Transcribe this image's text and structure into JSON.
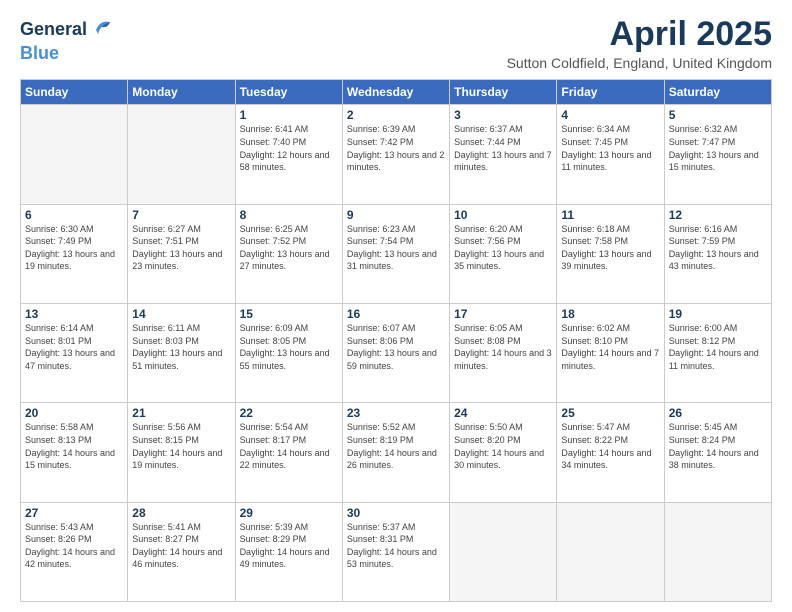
{
  "header": {
    "logo_line1": "General",
    "logo_line2": "Blue",
    "month_title": "April 2025",
    "location": "Sutton Coldfield, England, United Kingdom"
  },
  "weekdays": [
    "Sunday",
    "Monday",
    "Tuesday",
    "Wednesday",
    "Thursday",
    "Friday",
    "Saturday"
  ],
  "weeks": [
    [
      {
        "day": "",
        "empty": true
      },
      {
        "day": "",
        "empty": true
      },
      {
        "day": "1",
        "sunrise": "Sunrise: 6:41 AM",
        "sunset": "Sunset: 7:40 PM",
        "daylight": "Daylight: 12 hours and 58 minutes."
      },
      {
        "day": "2",
        "sunrise": "Sunrise: 6:39 AM",
        "sunset": "Sunset: 7:42 PM",
        "daylight": "Daylight: 13 hours and 2 minutes."
      },
      {
        "day": "3",
        "sunrise": "Sunrise: 6:37 AM",
        "sunset": "Sunset: 7:44 PM",
        "daylight": "Daylight: 13 hours and 7 minutes."
      },
      {
        "day": "4",
        "sunrise": "Sunrise: 6:34 AM",
        "sunset": "Sunset: 7:45 PM",
        "daylight": "Daylight: 13 hours and 11 minutes."
      },
      {
        "day": "5",
        "sunrise": "Sunrise: 6:32 AM",
        "sunset": "Sunset: 7:47 PM",
        "daylight": "Daylight: 13 hours and 15 minutes."
      }
    ],
    [
      {
        "day": "6",
        "sunrise": "Sunrise: 6:30 AM",
        "sunset": "Sunset: 7:49 PM",
        "daylight": "Daylight: 13 hours and 19 minutes."
      },
      {
        "day": "7",
        "sunrise": "Sunrise: 6:27 AM",
        "sunset": "Sunset: 7:51 PM",
        "daylight": "Daylight: 13 hours and 23 minutes."
      },
      {
        "day": "8",
        "sunrise": "Sunrise: 6:25 AM",
        "sunset": "Sunset: 7:52 PM",
        "daylight": "Daylight: 13 hours and 27 minutes."
      },
      {
        "day": "9",
        "sunrise": "Sunrise: 6:23 AM",
        "sunset": "Sunset: 7:54 PM",
        "daylight": "Daylight: 13 hours and 31 minutes."
      },
      {
        "day": "10",
        "sunrise": "Sunrise: 6:20 AM",
        "sunset": "Sunset: 7:56 PM",
        "daylight": "Daylight: 13 hours and 35 minutes."
      },
      {
        "day": "11",
        "sunrise": "Sunrise: 6:18 AM",
        "sunset": "Sunset: 7:58 PM",
        "daylight": "Daylight: 13 hours and 39 minutes."
      },
      {
        "day": "12",
        "sunrise": "Sunrise: 6:16 AM",
        "sunset": "Sunset: 7:59 PM",
        "daylight": "Daylight: 13 hours and 43 minutes."
      }
    ],
    [
      {
        "day": "13",
        "sunrise": "Sunrise: 6:14 AM",
        "sunset": "Sunset: 8:01 PM",
        "daylight": "Daylight: 13 hours and 47 minutes."
      },
      {
        "day": "14",
        "sunrise": "Sunrise: 6:11 AM",
        "sunset": "Sunset: 8:03 PM",
        "daylight": "Daylight: 13 hours and 51 minutes."
      },
      {
        "day": "15",
        "sunrise": "Sunrise: 6:09 AM",
        "sunset": "Sunset: 8:05 PM",
        "daylight": "Daylight: 13 hours and 55 minutes."
      },
      {
        "day": "16",
        "sunrise": "Sunrise: 6:07 AM",
        "sunset": "Sunset: 8:06 PM",
        "daylight": "Daylight: 13 hours and 59 minutes."
      },
      {
        "day": "17",
        "sunrise": "Sunrise: 6:05 AM",
        "sunset": "Sunset: 8:08 PM",
        "daylight": "Daylight: 14 hours and 3 minutes."
      },
      {
        "day": "18",
        "sunrise": "Sunrise: 6:02 AM",
        "sunset": "Sunset: 8:10 PM",
        "daylight": "Daylight: 14 hours and 7 minutes."
      },
      {
        "day": "19",
        "sunrise": "Sunrise: 6:00 AM",
        "sunset": "Sunset: 8:12 PM",
        "daylight": "Daylight: 14 hours and 11 minutes."
      }
    ],
    [
      {
        "day": "20",
        "sunrise": "Sunrise: 5:58 AM",
        "sunset": "Sunset: 8:13 PM",
        "daylight": "Daylight: 14 hours and 15 minutes."
      },
      {
        "day": "21",
        "sunrise": "Sunrise: 5:56 AM",
        "sunset": "Sunset: 8:15 PM",
        "daylight": "Daylight: 14 hours and 19 minutes."
      },
      {
        "day": "22",
        "sunrise": "Sunrise: 5:54 AM",
        "sunset": "Sunset: 8:17 PM",
        "daylight": "Daylight: 14 hours and 22 minutes."
      },
      {
        "day": "23",
        "sunrise": "Sunrise: 5:52 AM",
        "sunset": "Sunset: 8:19 PM",
        "daylight": "Daylight: 14 hours and 26 minutes."
      },
      {
        "day": "24",
        "sunrise": "Sunrise: 5:50 AM",
        "sunset": "Sunset: 8:20 PM",
        "daylight": "Daylight: 14 hours and 30 minutes."
      },
      {
        "day": "25",
        "sunrise": "Sunrise: 5:47 AM",
        "sunset": "Sunset: 8:22 PM",
        "daylight": "Daylight: 14 hours and 34 minutes."
      },
      {
        "day": "26",
        "sunrise": "Sunrise: 5:45 AM",
        "sunset": "Sunset: 8:24 PM",
        "daylight": "Daylight: 14 hours and 38 minutes."
      }
    ],
    [
      {
        "day": "27",
        "sunrise": "Sunrise: 5:43 AM",
        "sunset": "Sunset: 8:26 PM",
        "daylight": "Daylight: 14 hours and 42 minutes."
      },
      {
        "day": "28",
        "sunrise": "Sunrise: 5:41 AM",
        "sunset": "Sunset: 8:27 PM",
        "daylight": "Daylight: 14 hours and 46 minutes."
      },
      {
        "day": "29",
        "sunrise": "Sunrise: 5:39 AM",
        "sunset": "Sunset: 8:29 PM",
        "daylight": "Daylight: 14 hours and 49 minutes."
      },
      {
        "day": "30",
        "sunrise": "Sunrise: 5:37 AM",
        "sunset": "Sunset: 8:31 PM",
        "daylight": "Daylight: 14 hours and 53 minutes."
      },
      {
        "day": "",
        "empty": true
      },
      {
        "day": "",
        "empty": true
      },
      {
        "day": "",
        "empty": true
      }
    ]
  ]
}
